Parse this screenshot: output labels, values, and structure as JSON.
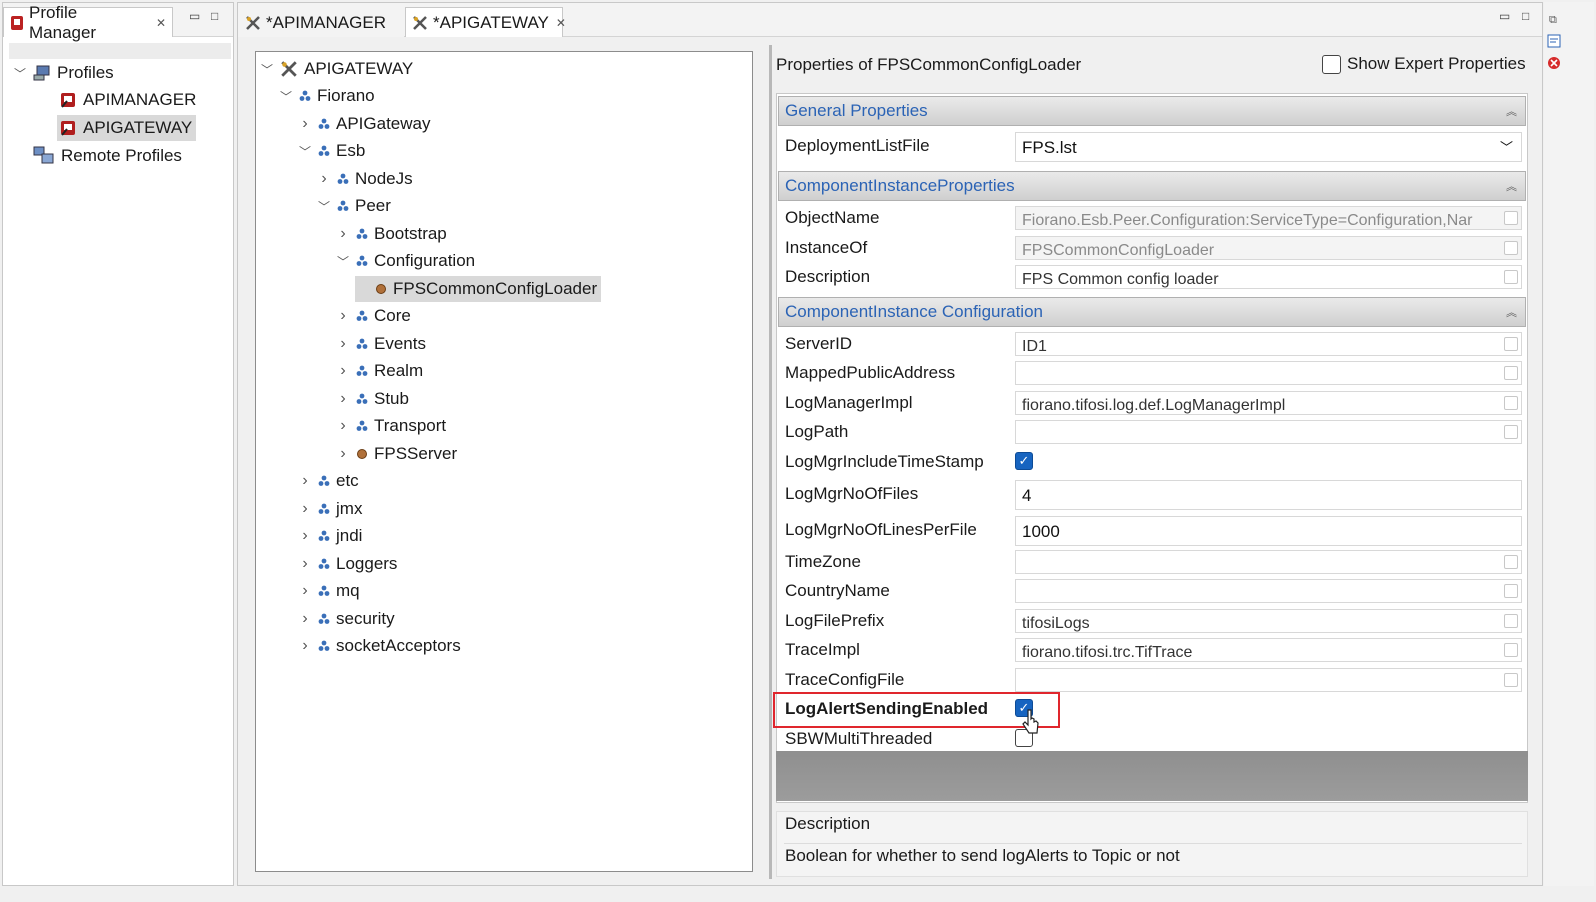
{
  "profile_manager": {
    "tab_label": "Profile Manager",
    "root_label": "Profiles",
    "profiles": [
      "APIMANAGER",
      "APIGATEWAY"
    ],
    "remote_label": "Remote Profiles"
  },
  "editor_tabs": [
    "*APIMANAGER",
    "*APIGATEWAY"
  ],
  "tree": {
    "root": "APIGATEWAY",
    "nodes": [
      {
        "label": "Fiorano"
      },
      {
        "label": "APIGateway"
      },
      {
        "label": "Esb"
      },
      {
        "label": "NodeJs"
      },
      {
        "label": "Peer"
      },
      {
        "label": "Bootstrap"
      },
      {
        "label": "Configuration"
      },
      {
        "label": "FPSCommonConfigLoader"
      },
      {
        "label": "Core"
      },
      {
        "label": "Events"
      },
      {
        "label": "Realm"
      },
      {
        "label": "Stub"
      },
      {
        "label": "Transport"
      },
      {
        "label": "FPSServer"
      },
      {
        "label": "etc"
      },
      {
        "label": "jmx"
      },
      {
        "label": "jndi"
      },
      {
        "label": "Loggers"
      },
      {
        "label": "mq"
      },
      {
        "label": "security"
      },
      {
        "label": "socketAcceptors"
      }
    ]
  },
  "properties": {
    "title": "Properties of FPSCommonConfigLoader",
    "show_expert_label": "Show Expert Properties",
    "sections": [
      {
        "title": "General Properties"
      },
      {
        "title": "ComponentInstanceProperties"
      },
      {
        "title": "ComponentInstance Configuration"
      }
    ],
    "general": [
      {
        "name": "DeploymentListFile",
        "value": "FPS.lst"
      }
    ],
    "instance": [
      {
        "name": "ObjectName",
        "value": "Fiorano.Esb.Peer.Configuration:ServiceType=Configuration,Nar"
      },
      {
        "name": "InstanceOf",
        "value": "FPSCommonConfigLoader"
      },
      {
        "name": "Description",
        "value": "FPS Common config loader"
      }
    ],
    "config": [
      {
        "name": "ServerID",
        "value": "ID1"
      },
      {
        "name": "MappedPublicAddress",
        "value": ""
      },
      {
        "name": "LogManagerImpl",
        "value": "fiorano.tifosi.log.def.LogManagerImpl"
      },
      {
        "name": "LogPath",
        "value": ""
      },
      {
        "name": "LogMgrIncludeTimeStamp",
        "value": ""
      },
      {
        "name": "LogMgrNoOfFiles",
        "value": "4"
      },
      {
        "name": "LogMgrNoOfLinesPerFile",
        "value": "1000"
      },
      {
        "name": "TimeZone",
        "value": ""
      },
      {
        "name": "CountryName",
        "value": ""
      },
      {
        "name": "LogFilePrefix",
        "value": "tifosiLogs"
      },
      {
        "name": "TraceImpl",
        "value": "fiorano.tifosi.trc.TifTrace"
      },
      {
        "name": "TraceConfigFile",
        "value": ""
      },
      {
        "name": "LogAlertSendingEnabled",
        "value": ""
      },
      {
        "name": "SBWMultiThreaded",
        "value": ""
      }
    ],
    "description_title": "Description",
    "description_text": "Boolean for whether to send logAlerts to Topic or not"
  },
  "colors": {
    "accent": "#2b63b5",
    "highlight_box": "#e0262d",
    "checkbox_on": "#1764c0"
  }
}
